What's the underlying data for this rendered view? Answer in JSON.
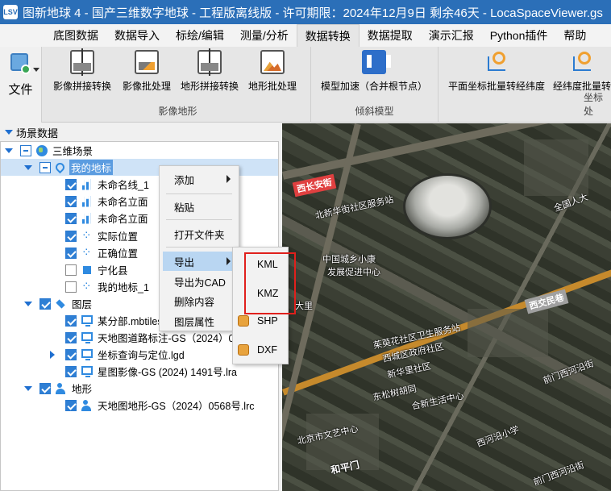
{
  "title": {
    "logo_text": "LSV",
    "text": "图新地球 4 - 国产三维数字地球 - 工程版离线版 - 许可期限：2024年12月9日 剩余46天 - LocaSpaceViewer.gs"
  },
  "menu": {
    "tabs": [
      {
        "label": "底图数据"
      },
      {
        "label": "数据导入"
      },
      {
        "label": "标绘/编辑"
      },
      {
        "label": "测量/分析"
      },
      {
        "label": "数据转换",
        "active": true
      },
      {
        "label": "数据提取"
      },
      {
        "label": "演示汇报"
      },
      {
        "label": "Python插件"
      },
      {
        "label": "帮助"
      }
    ]
  },
  "ribbon": {
    "file_label": "文件",
    "groups": [
      {
        "label": "影像地形",
        "buttons": [
          {
            "label": "影像拼接转换",
            "icon": "image-mosaic-icon"
          },
          {
            "label": "影像批处理",
            "icon": "image-batch-icon"
          },
          {
            "label": "地形拼接转换",
            "icon": "terrain-mosaic-icon"
          },
          {
            "label": "地形批处理",
            "icon": "terrain-batch-icon"
          }
        ]
      },
      {
        "label": "倾斜模型",
        "buttons": [
          {
            "label": "模型加速（合并根节点）",
            "icon": "model-speed-icon"
          }
        ]
      },
      {
        "label": "坐标处",
        "buttons": [
          {
            "label": "平面坐标批量转经纬度",
            "icon": "coord-convert-icon"
          },
          {
            "label": "经纬度批量转",
            "icon": "coord-convert-icon"
          }
        ]
      }
    ]
  },
  "panel": {
    "header": "场景数据",
    "tree": [
      {
        "label": "三维场景",
        "level": 0,
        "check": "partial",
        "icon": "globe-icon",
        "expand": "down"
      },
      {
        "label": "我的地标",
        "level": 1,
        "check": "partial",
        "icon": "pin-icon",
        "expand": "down",
        "selected": true
      },
      {
        "label": "未命名线_1",
        "level": 2,
        "check": "checked",
        "icon": "bars-icon"
      },
      {
        "label": "未命名立面",
        "level": 2,
        "check": "checked",
        "icon": "bars-icon"
      },
      {
        "label": "未命名立面",
        "level": 2,
        "check": "checked",
        "icon": "bars-icon"
      },
      {
        "label": "实际位置",
        "level": 2,
        "check": "checked",
        "icon": "dots-icon"
      },
      {
        "label": "正确位置",
        "level": 2,
        "check": "checked",
        "icon": "dots-icon"
      },
      {
        "label": "宁化县",
        "level": 2,
        "check": "unchecked",
        "icon": "square-icon"
      },
      {
        "label": "我的地标_1",
        "level": 2,
        "check": "unchecked",
        "icon": "dots-icon"
      },
      {
        "label": "图层",
        "level": 1,
        "check": "checked",
        "icon": "layers-icon",
        "expand": "down"
      },
      {
        "label": "某分部.mbtiles",
        "level": 2,
        "check": "checked",
        "icon": "monitor-icon"
      },
      {
        "label": "天地图道路标注-GS（2024）0",
        "level": 2,
        "check": "checked",
        "icon": "monitor-icon"
      },
      {
        "label": "坐标查询与定位.lgd",
        "level": 2,
        "check": "checked",
        "icon": "monitor-icon",
        "expand": "right"
      },
      {
        "label": "星图影像-GS (2024) 1491号.lra",
        "level": 2,
        "check": "checked",
        "icon": "monitor-icon"
      },
      {
        "label": "地形",
        "level": 1,
        "check": "checked",
        "icon": "people-icon",
        "expand": "down"
      },
      {
        "label": "天地图地形-GS（2024）0568号.lrc",
        "level": 2,
        "check": "checked",
        "icon": "people-icon"
      }
    ]
  },
  "context_menu": {
    "items": [
      {
        "label": "添加",
        "submenu": true
      },
      {
        "label": "粘贴"
      },
      {
        "label": "打开文件夹"
      },
      {
        "label": "导出",
        "submenu": true,
        "hover": true
      },
      {
        "label": "导出为CAD"
      },
      {
        "label": "删除内容"
      },
      {
        "label": "图层属性"
      }
    ]
  },
  "submenu": {
    "items": [
      {
        "label": "KML"
      },
      {
        "label": "KMZ"
      },
      {
        "label": "SHP"
      },
      {
        "label": "DXF"
      }
    ],
    "highlight_color": "#e0201c"
  },
  "map": {
    "labels": [
      {
        "text": "西长安街",
        "style": "tag"
      },
      {
        "text": "北新华街社区服务站"
      },
      {
        "text": "中国城乡小康"
      },
      {
        "text": "发展促进中心"
      },
      {
        "text": "西交民巷",
        "style": "tag-gray"
      },
      {
        "text": "大里"
      },
      {
        "text": "茱萸花社区卫生服务站"
      },
      {
        "text": "西城区政府社区"
      },
      {
        "text": "东松树胡同"
      },
      {
        "text": "新华里社区"
      },
      {
        "text": "合新生活中心"
      },
      {
        "text": "西河沿小学"
      },
      {
        "text": "北京市文艺中心"
      },
      {
        "text": "和平门",
        "style": "big"
      },
      {
        "text": "全国人大"
      },
      {
        "text": "前门西河沿街"
      },
      {
        "text": "前门西河沿街"
      }
    ]
  },
  "colors": {
    "titlebar": "#2b6fb8",
    "accent": "#2f7fd4",
    "highlight": "#e0201c"
  }
}
